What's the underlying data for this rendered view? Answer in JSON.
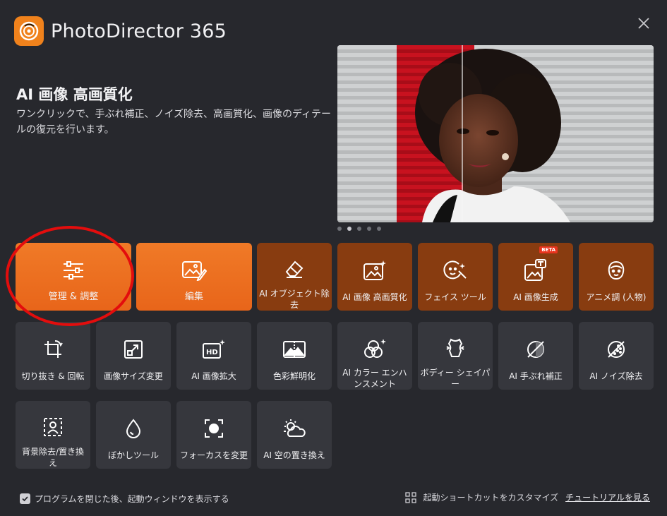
{
  "app": {
    "title": "PhotoDirector 365"
  },
  "feature": {
    "title": "AI 画像 高画質化",
    "description": "ワンクリックで、手ぶれ補正、ノイズ除去、高画質化、画像のディテールの復元を行います。"
  },
  "carousel": {
    "count": 5,
    "active_index": 1
  },
  "tiles_row1": [
    {
      "label": "管理 & 調整",
      "icon": "sliders-icon"
    },
    {
      "label": "編集",
      "icon": "photo-edit-icon"
    },
    {
      "label": "AI オブジェクト除去",
      "icon": "eraser-icon"
    },
    {
      "label": "AI 画像 高画質化",
      "icon": "ai-enhance-icon"
    },
    {
      "label": "フェイス ツール",
      "icon": "face-wand-icon"
    },
    {
      "label": "AI 画像生成",
      "icon": "ai-image-gen-icon",
      "badge": "BETA"
    },
    {
      "label": "アニメ調 (人物)",
      "icon": "anime-person-icon"
    }
  ],
  "tiles_row2": [
    {
      "label": "切り抜き & 回転",
      "icon": "crop-rotate-icon"
    },
    {
      "label": "画像サイズ変更",
      "icon": "resize-icon"
    },
    {
      "label": "AI 画像拡大",
      "icon": "hd-upscale-icon"
    },
    {
      "label": "色彩鮮明化",
      "icon": "color-vivid-icon"
    },
    {
      "label": "AI カラー エンハンスメント",
      "icon": "color-circles-icon"
    },
    {
      "label": "ボディー シェイパー",
      "icon": "body-shaper-icon"
    },
    {
      "label": "AI 手ぶれ補正",
      "icon": "deblur-icon"
    },
    {
      "label": "AI ノイズ除去",
      "icon": "denoise-icon"
    }
  ],
  "tiles_row3": [
    {
      "label": "背景除去/置き換え",
      "icon": "person-cutout-icon"
    },
    {
      "label": "ぼかしツール",
      "icon": "blur-drop-icon"
    },
    {
      "label": "フォーカスを変更",
      "icon": "focus-icon"
    },
    {
      "label": "AI 空の置き換え",
      "icon": "sky-replace-icon"
    }
  ],
  "footer": {
    "show_on_close_label": "プログラムを閉じた後、起動ウィンドウを表示する",
    "show_on_close_checked": true,
    "customize_label": "起動ショートカットをカスタマイズ",
    "tutorial_label": "チュートリアルを見る"
  },
  "colors": {
    "background": "#27282d",
    "primary_tile": "#ec6f20",
    "dark_orange_tile": "#883c10",
    "gray_tile": "#36373d",
    "highlight_ring": "#e30d0d"
  }
}
